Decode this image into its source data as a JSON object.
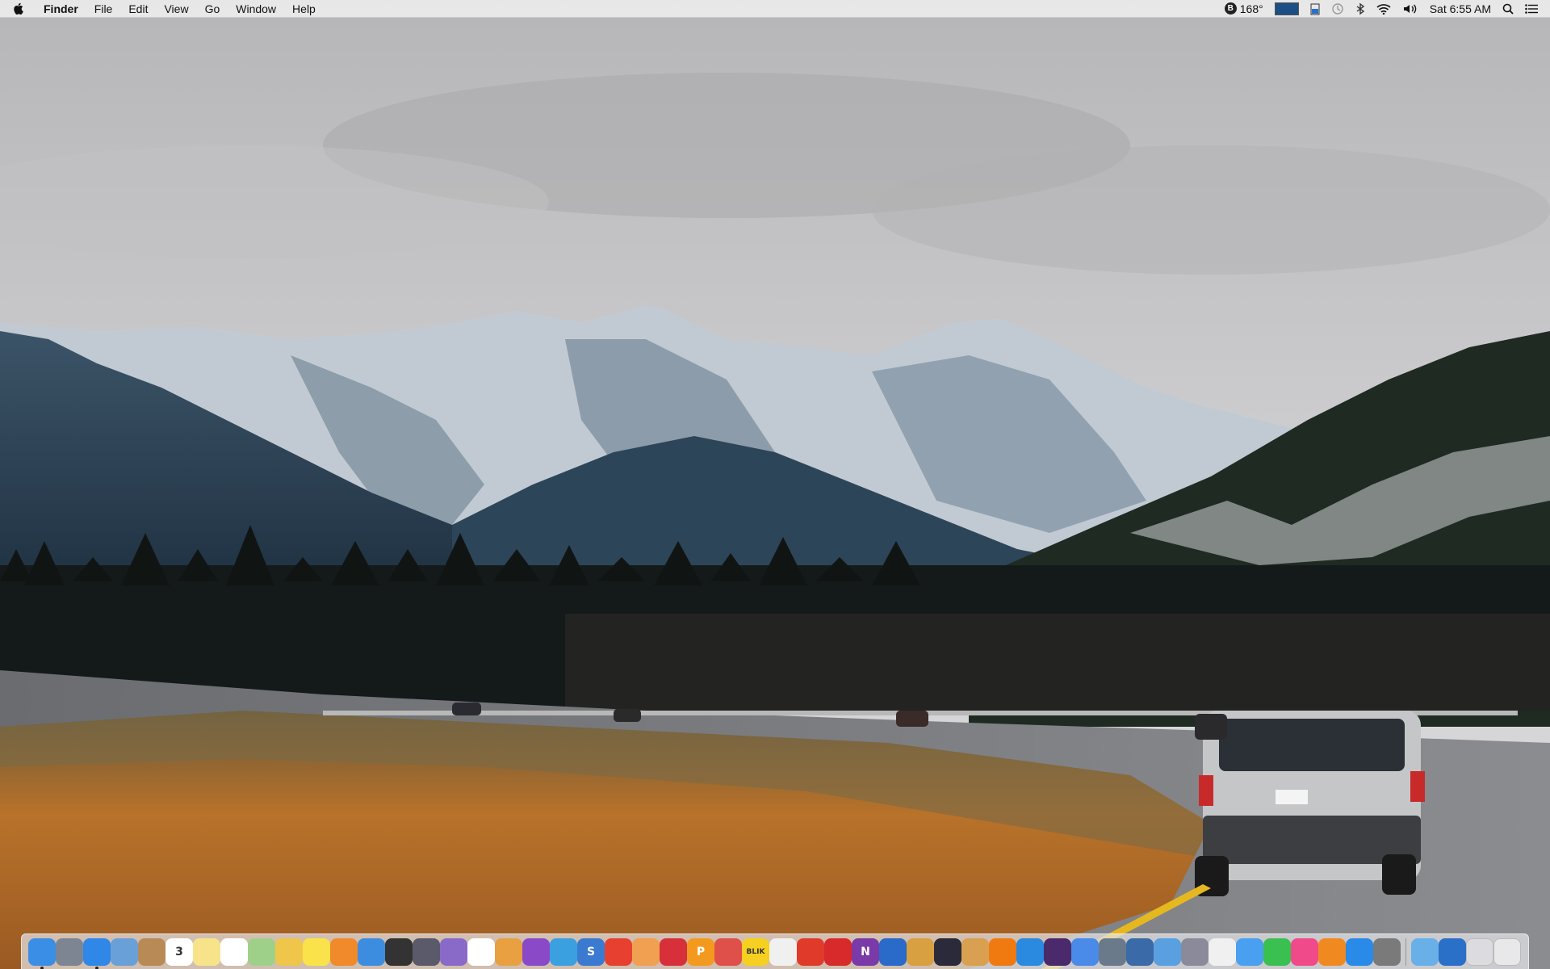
{
  "menubar": {
    "app_name": "Finder",
    "menus": [
      "File",
      "Edit",
      "View",
      "Go",
      "Window",
      "Help"
    ],
    "status": {
      "temperature": "168°",
      "clock": "Sat 6:55 AM"
    }
  },
  "dock": {
    "items": [
      {
        "icon": "finder-icon",
        "color": "#3a8ee6",
        "label": "",
        "running": true
      },
      {
        "icon": "launchpad-icon",
        "color": "#7d8592",
        "label": ""
      },
      {
        "icon": "safari-icon",
        "color": "#2f87e8",
        "label": "",
        "running": true
      },
      {
        "icon": "preview-icon",
        "color": "#6aa0d8",
        "label": ""
      },
      {
        "icon": "contacts-icon",
        "color": "#b88a55",
        "label": ""
      },
      {
        "icon": "calendar-icon",
        "color": "#ffffff",
        "label": "3"
      },
      {
        "icon": "notes-icon",
        "color": "#f7e48a",
        "label": ""
      },
      {
        "icon": "reminders-icon",
        "color": "#ffffff",
        "label": ""
      },
      {
        "icon": "maps-icon",
        "color": "#9fd08a",
        "label": ""
      },
      {
        "icon": "todo-icon",
        "color": "#f0c64a",
        "label": ""
      },
      {
        "icon": "stickies-icon",
        "color": "#f9e24a",
        "label": ""
      },
      {
        "icon": "pin-icon",
        "color": "#f08a2a",
        "label": ""
      },
      {
        "icon": "downloads-icon",
        "color": "#3c8de0",
        "label": ""
      },
      {
        "icon": "cursor-icon",
        "color": "#333333",
        "label": ""
      },
      {
        "icon": "disk-icon",
        "color": "#5a5a6a",
        "label": ""
      },
      {
        "icon": "photos-slides-icon",
        "color": "#8a6ac8",
        "label": ""
      },
      {
        "icon": "link-icon",
        "color": "#ffffff",
        "label": ""
      },
      {
        "icon": "scanner-icon",
        "color": "#e8a040",
        "label": ""
      },
      {
        "icon": "cleaner-icon",
        "color": "#8a4ac8",
        "label": ""
      },
      {
        "icon": "firefox-icon",
        "color": "#3aa0e0",
        "label": ""
      },
      {
        "icon": "scrivener-icon",
        "color": "#3a7ad0",
        "label": "S"
      },
      {
        "icon": "blimp-icon",
        "color": "#e84030",
        "label": ""
      },
      {
        "icon": "colorsync-icon",
        "color": "#f0a050",
        "label": ""
      },
      {
        "icon": "pushpin-icon",
        "color": "#d8303a",
        "label": ""
      },
      {
        "icon": "pages-icon",
        "color": "#f39a1e",
        "label": "P"
      },
      {
        "icon": "hand-icon",
        "color": "#e0504a",
        "label": ""
      },
      {
        "icon": "blik-icon",
        "color": "#f5d020",
        "label": "BLIK"
      },
      {
        "icon": "document-icon",
        "color": "#f0f0f0",
        "label": ""
      },
      {
        "icon": "record-icon",
        "color": "#e03a2a",
        "label": ""
      },
      {
        "icon": "arrow-icon",
        "color": "#d82a2a",
        "label": ""
      },
      {
        "icon": "onenote-icon",
        "color": "#7a3aa8",
        "label": "N"
      },
      {
        "icon": "1password-icon",
        "color": "#2a6ac8",
        "label": ""
      },
      {
        "icon": "pinwheel-icon",
        "color": "#d8a040",
        "label": ""
      },
      {
        "icon": "grapher-icon",
        "color": "#2a2a3a",
        "label": ""
      },
      {
        "icon": "script-icon",
        "color": "#d8a050",
        "label": ""
      },
      {
        "icon": "vlc-icon",
        "color": "#f07a10",
        "label": ""
      },
      {
        "icon": "player-icon",
        "color": "#2a8ae0",
        "label": ""
      },
      {
        "icon": "music-player-icon",
        "color": "#4a2a6a",
        "label": ""
      },
      {
        "icon": "chrome-icon",
        "color": "#4a8ae8",
        "label": ""
      },
      {
        "icon": "network-icon",
        "color": "#6a7a8a",
        "label": ""
      },
      {
        "icon": "vpn-icon",
        "color": "#3a6aa8",
        "label": ""
      },
      {
        "icon": "ice-icon",
        "color": "#5aa0e0",
        "label": ""
      },
      {
        "icon": "spray-icon",
        "color": "#8a8a9a",
        "label": ""
      },
      {
        "icon": "photos-icon",
        "color": "#f0f0f0",
        "label": ""
      },
      {
        "icon": "messages-icon",
        "color": "#4aa0f0",
        "label": ""
      },
      {
        "icon": "facetime-icon",
        "color": "#3ac050",
        "label": ""
      },
      {
        "icon": "itunes-icon",
        "color": "#f04a8a",
        "label": ""
      },
      {
        "icon": "ibooks-icon",
        "color": "#f08a20",
        "label": ""
      },
      {
        "icon": "app-store-icon",
        "color": "#2a8ae8",
        "label": ""
      },
      {
        "icon": "system-preferences-icon",
        "color": "#7a7a7a",
        "label": ""
      },
      {
        "separator": true
      },
      {
        "icon": "desktop-folder-icon",
        "color": "#6ab0e8",
        "label": ""
      },
      {
        "icon": "globe-icon",
        "color": "#2a70c8",
        "label": ""
      },
      {
        "icon": "downloads-stack-icon",
        "color": "#dcdce0",
        "label": ""
      },
      {
        "icon": "trash-icon",
        "color": "#e8e8ea",
        "label": ""
      }
    ]
  }
}
